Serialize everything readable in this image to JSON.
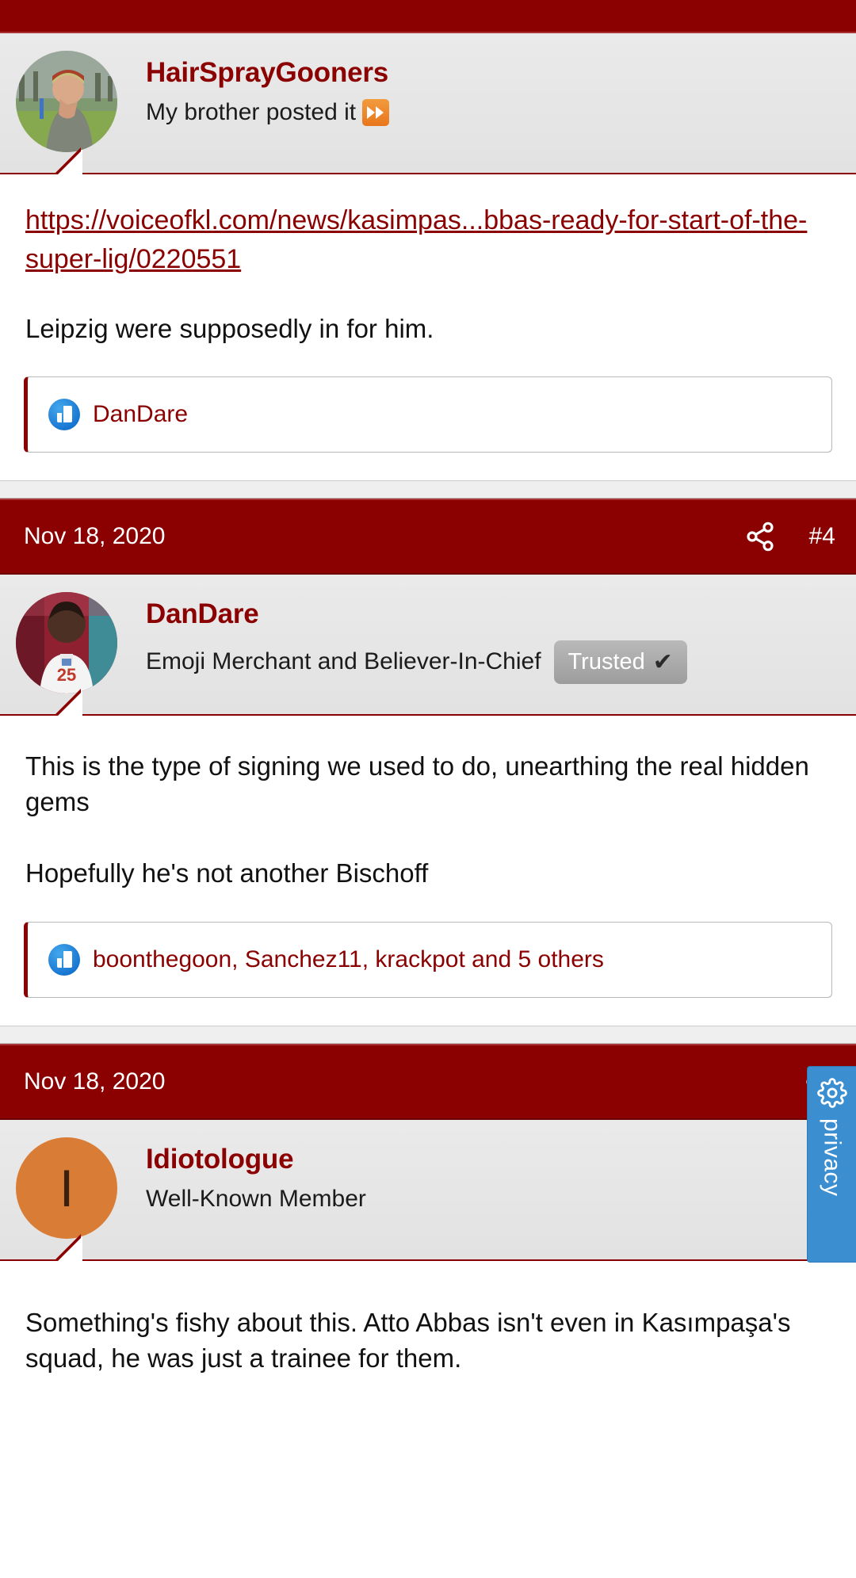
{
  "theme": {
    "brand_color": "#8b0000",
    "header_bg": "#e4e4e4",
    "link_color": "#8b0000",
    "privacy_tab_color": "#3b8ed0",
    "avatar_initial_bg": "#d97c35"
  },
  "posts": [
    {
      "author": "HairSprayGooners",
      "user_title": "My brother posted it",
      "user_title_emoji": "fast-forward-emoji",
      "link_text": "https://voiceofkl.com/news/kasimpas...bbas-ready-for-start-of-the-super-lig/0220551",
      "body": "Leipzig were supposedly in for him.",
      "likes": "DanDare",
      "avatar_type": "photo-man-in-beanie"
    },
    {
      "date": "Nov 18, 2020",
      "post_number": "#4",
      "share_icon": "share-icon",
      "author": "DanDare",
      "user_title": "Emoji Merchant and Believer-In-Chief",
      "badge_label": "Trusted",
      "badge_check": "✔",
      "body": "This is the type of signing we used to do, unearthing the real hidden gems\n\nHopefully he's not another Bischoff",
      "likes": "boonthegoon, Sanchez11, krackpot and 5 others",
      "avatar_type": "photo-footballer-25"
    },
    {
      "date": "Nov 18, 2020",
      "share_icon": "share-icon",
      "author": "Idiotologue",
      "user_title": "Well-Known Member",
      "avatar_initial": "I",
      "body": "Something's fishy about this. Atto Abbas isn't even in Kasımpaşa's squad, he was just a trainee for them."
    }
  ],
  "privacy_tab": {
    "label": "privacy",
    "icon": "gear-icon"
  }
}
